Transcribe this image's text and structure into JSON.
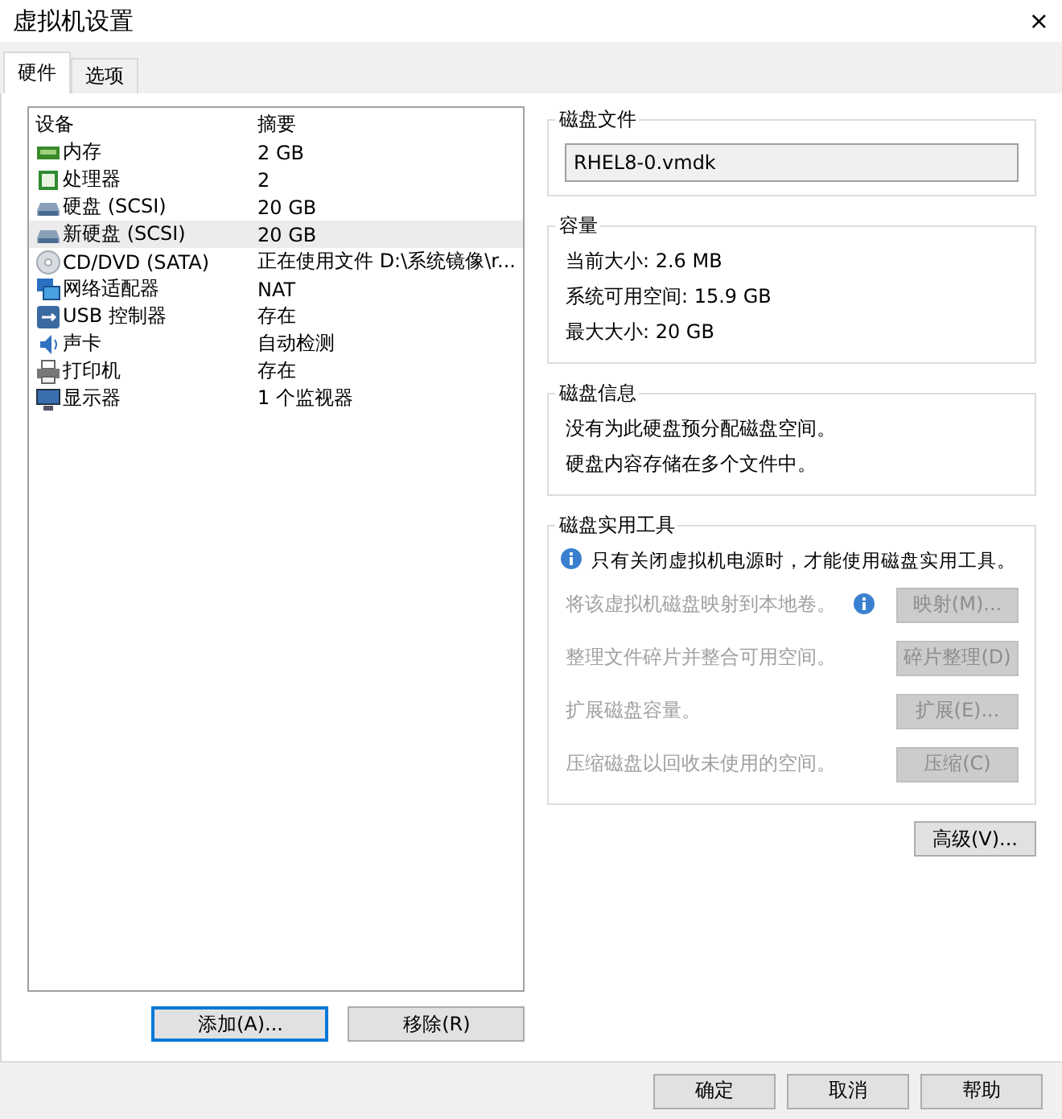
{
  "window": {
    "title": "虚拟机设置",
    "close": "×"
  },
  "tabs": [
    {
      "label": "硬件",
      "selected": true
    },
    {
      "label": "选项",
      "selected": false
    }
  ],
  "devices": {
    "columns": [
      "设备",
      "摘要"
    ],
    "rows": [
      {
        "kind": "memory",
        "name": "内存",
        "summary": "2 GB",
        "selected": false
      },
      {
        "kind": "cpu",
        "name": "处理器",
        "summary": "2",
        "selected": false
      },
      {
        "kind": "disk",
        "name": "硬盘 (SCSI)",
        "summary": "20 GB",
        "selected": false
      },
      {
        "kind": "disk",
        "name": "新硬盘 (SCSI)",
        "summary": "20 GB",
        "selected": true
      },
      {
        "kind": "cdrom",
        "name": "CD/DVD (SATA)",
        "summary": "正在使用文件 D:\\系统镜像\\r...",
        "selected": false
      },
      {
        "kind": "network",
        "name": "网络适配器",
        "summary": "NAT",
        "selected": false
      },
      {
        "kind": "usb",
        "name": "USB 控制器",
        "summary": "存在",
        "selected": false
      },
      {
        "kind": "sound",
        "name": "声卡",
        "summary": "自动检测",
        "selected": false
      },
      {
        "kind": "printer",
        "name": "打印机",
        "summary": "存在",
        "selected": false
      },
      {
        "kind": "monitor",
        "name": "显示器",
        "summary": "1 个监视器",
        "selected": false
      }
    ],
    "buttons": [
      {
        "label": "添加(A)...",
        "focused": true
      },
      {
        "label": "移除(R)",
        "focused": false
      }
    ]
  },
  "disk_file": {
    "title": "磁盘文件",
    "value": "RHEL8-0.vmdk"
  },
  "capacity": {
    "title": "容量",
    "lines": [
      "当前大小: 2.6 MB",
      "系统可用空间: 15.9 GB",
      "最大大小: 20 GB"
    ]
  },
  "disk_info": {
    "title": "磁盘信息",
    "lines": [
      "没有为此硬盘预分配磁盘空间。",
      "硬盘内容存储在多个文件中。"
    ]
  },
  "utilities": {
    "title": "磁盘实用工具",
    "notice": "只有关闭虚拟机电源时，才能使用磁盘实用工具。",
    "rows": [
      {
        "text": "将该虚拟机磁盘映射到本地卷。",
        "info": true,
        "button": "映射(M)...",
        "disabled": true
      },
      {
        "text": "整理文件碎片并整合可用空间。",
        "info": false,
        "button": "碎片整理(D)",
        "disabled": true
      },
      {
        "text": "扩展磁盘容量。",
        "info": false,
        "button": "扩展(E)...",
        "disabled": true
      },
      {
        "text": "压缩磁盘以回收未使用的空间。",
        "info": false,
        "button": "压缩(C)",
        "disabled": true
      }
    ]
  },
  "advanced_button": "高级(V)...",
  "footer_buttons": [
    "确定",
    "取消",
    "帮助"
  ]
}
